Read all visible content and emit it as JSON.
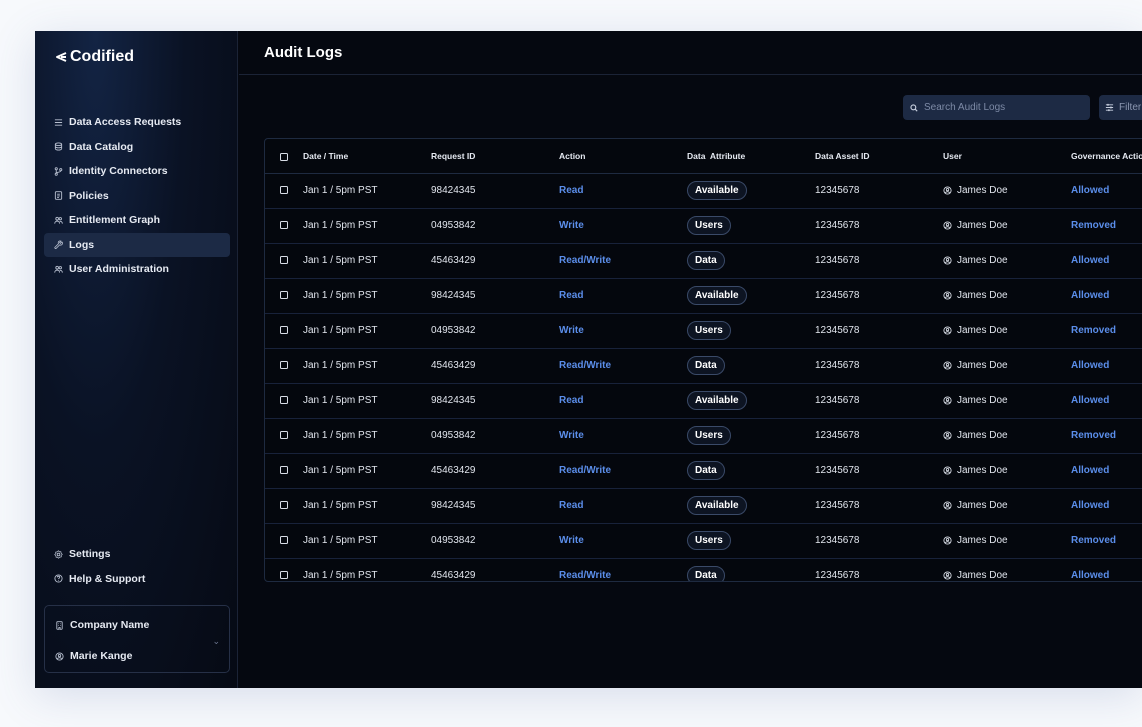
{
  "app": {
    "name": "Codified"
  },
  "sidebar": {
    "items": [
      {
        "label": "Data Access Requests",
        "icon": "list-icon",
        "active": false
      },
      {
        "label": "Data Catalog",
        "icon": "database-icon",
        "active": false
      },
      {
        "label": "Identity Connectors",
        "icon": "git-branch-icon",
        "active": false
      },
      {
        "label": "Policies",
        "icon": "document-icon",
        "active": false
      },
      {
        "label": "Entitlement Graph",
        "icon": "users-icon",
        "active": false
      },
      {
        "label": "Logs",
        "icon": "wrench-icon",
        "active": true
      },
      {
        "label": "User Administration",
        "icon": "users-icon",
        "active": false
      }
    ],
    "bottom_items": [
      {
        "label": "Settings",
        "icon": "gear-icon"
      },
      {
        "label": "Help & Support",
        "icon": "help-icon"
      }
    ],
    "company": {
      "company_name": "Company Name",
      "user_name": "Marie Kange"
    }
  },
  "header": {
    "title": "Audit Logs"
  },
  "toolbar": {
    "search_placeholder": "Search Audit Logs",
    "filter_label": "Filter"
  },
  "table": {
    "columns": [
      "Date / Time",
      "Request ID",
      "Action",
      "Data  Attribute",
      "Data Asset ID",
      "User",
      "Governance Action"
    ],
    "rows": [
      {
        "date": "Jan 1 / 5pm PST",
        "request_id": "98424345",
        "action": "Read",
        "attribute": "Available",
        "asset_id": "12345678",
        "user": "James Doe",
        "governance": "Allowed"
      },
      {
        "date": "Jan 1 / 5pm PST",
        "request_id": "04953842",
        "action": "Write",
        "attribute": "Users",
        "asset_id": "12345678",
        "user": "James Doe",
        "governance": "Removed"
      },
      {
        "date": "Jan 1 / 5pm PST",
        "request_id": "45463429",
        "action": "Read/Write",
        "attribute": "Data",
        "asset_id": "12345678",
        "user": "James Doe",
        "governance": "Allowed"
      },
      {
        "date": "Jan 1 / 5pm PST",
        "request_id": "98424345",
        "action": "Read",
        "attribute": "Available",
        "asset_id": "12345678",
        "user": "James Doe",
        "governance": "Allowed"
      },
      {
        "date": "Jan 1 / 5pm PST",
        "request_id": "04953842",
        "action": "Write",
        "attribute": "Users",
        "asset_id": "12345678",
        "user": "James Doe",
        "governance": "Removed"
      },
      {
        "date": "Jan 1 / 5pm PST",
        "request_id": "45463429",
        "action": "Read/Write",
        "attribute": "Data",
        "asset_id": "12345678",
        "user": "James Doe",
        "governance": "Allowed"
      },
      {
        "date": "Jan 1 / 5pm PST",
        "request_id": "98424345",
        "action": "Read",
        "attribute": "Available",
        "asset_id": "12345678",
        "user": "James Doe",
        "governance": "Allowed"
      },
      {
        "date": "Jan 1 / 5pm PST",
        "request_id": "04953842",
        "action": "Write",
        "attribute": "Users",
        "asset_id": "12345678",
        "user": "James Doe",
        "governance": "Removed"
      },
      {
        "date": "Jan 1 / 5pm PST",
        "request_id": "45463429",
        "action": "Read/Write",
        "attribute": "Data",
        "asset_id": "12345678",
        "user": "James Doe",
        "governance": "Allowed"
      },
      {
        "date": "Jan 1 / 5pm PST",
        "request_id": "98424345",
        "action": "Read",
        "attribute": "Available",
        "asset_id": "12345678",
        "user": "James Doe",
        "governance": "Allowed"
      },
      {
        "date": "Jan 1 / 5pm PST",
        "request_id": "04953842",
        "action": "Write",
        "attribute": "Users",
        "asset_id": "12345678",
        "user": "James Doe",
        "governance": "Removed"
      },
      {
        "date": "Jan 1 / 5pm PST",
        "request_id": "45463429",
        "action": "Read/Write",
        "attribute": "Data",
        "asset_id": "12345678",
        "user": "James Doe",
        "governance": "Allowed"
      }
    ]
  },
  "colors": {
    "accent_link": "#5b8eea",
    "background": "#050810",
    "active_nav": "#1c2a45"
  }
}
